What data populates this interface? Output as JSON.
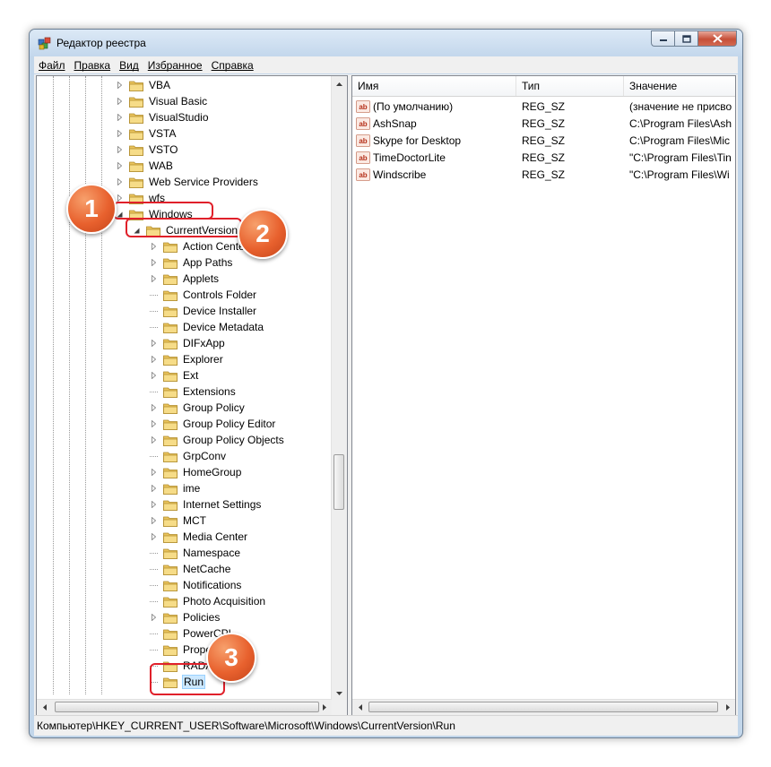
{
  "window": {
    "title": "Редактор реестра"
  },
  "menu": [
    "Файл",
    "Правка",
    "Вид",
    "Избранное",
    "Справка"
  ],
  "tree": [
    {
      "label": "VBA",
      "expander": "collapsed",
      "level": 0
    },
    {
      "label": "Visual Basic",
      "expander": "collapsed",
      "level": 0
    },
    {
      "label": "VisualStudio",
      "expander": "collapsed",
      "level": 0
    },
    {
      "label": "VSTA",
      "expander": "collapsed",
      "level": 0
    },
    {
      "label": "VSTO",
      "expander": "collapsed",
      "level": 0
    },
    {
      "label": "WAB",
      "expander": "collapsed",
      "level": 0
    },
    {
      "label": "Web Service Providers",
      "expander": "collapsed",
      "level": 0
    },
    {
      "label": "wfs",
      "expander": "collapsed",
      "level": 0
    },
    {
      "label": "Windows",
      "expander": "expanded",
      "level": 0
    },
    {
      "label": "CurrentVersion",
      "expander": "expanded",
      "level": 1
    },
    {
      "label": "Action Center",
      "expander": "collapsed",
      "level": 2
    },
    {
      "label": "App Paths",
      "expander": "collapsed",
      "level": 2
    },
    {
      "label": "Applets",
      "expander": "collapsed",
      "level": 2
    },
    {
      "label": "Controls Folder",
      "expander": "none",
      "level": 2
    },
    {
      "label": "Device Installer",
      "expander": "none",
      "level": 2
    },
    {
      "label": "Device Metadata",
      "expander": "none",
      "level": 2
    },
    {
      "label": "DIFxApp",
      "expander": "collapsed",
      "level": 2
    },
    {
      "label": "Explorer",
      "expander": "collapsed",
      "level": 2
    },
    {
      "label": "Ext",
      "expander": "collapsed",
      "level": 2
    },
    {
      "label": "Extensions",
      "expander": "none",
      "level": 2
    },
    {
      "label": "Group Policy",
      "expander": "collapsed",
      "level": 2
    },
    {
      "label": "Group Policy Editor",
      "expander": "collapsed",
      "level": 2
    },
    {
      "label": "Group Policy Objects",
      "expander": "collapsed",
      "level": 2
    },
    {
      "label": "GrpConv",
      "expander": "none",
      "level": 2
    },
    {
      "label": "HomeGroup",
      "expander": "collapsed",
      "level": 2
    },
    {
      "label": "ime",
      "expander": "collapsed",
      "level": 2
    },
    {
      "label": "Internet Settings",
      "expander": "collapsed",
      "level": 2
    },
    {
      "label": "MCT",
      "expander": "collapsed",
      "level": 2
    },
    {
      "label": "Media Center",
      "expander": "collapsed",
      "level": 2
    },
    {
      "label": "Namespace",
      "expander": "none",
      "level": 2
    },
    {
      "label": "NetCache",
      "expander": "none",
      "level": 2
    },
    {
      "label": "Notifications",
      "expander": "none",
      "level": 2
    },
    {
      "label": "Photo Acquisition",
      "expander": "none",
      "level": 2
    },
    {
      "label": "Policies",
      "expander": "collapsed",
      "level": 2
    },
    {
      "label": "PowerCPL",
      "expander": "none",
      "level": 2
    },
    {
      "label": "Prope",
      "expander": "none",
      "level": 2
    },
    {
      "label": "RADAR",
      "expander": "none",
      "level": 2
    },
    {
      "label": "Run",
      "expander": "none",
      "level": 2,
      "selected": true
    }
  ],
  "list": {
    "columns": [
      "Имя",
      "Тип",
      "Значение"
    ],
    "rows": [
      {
        "name": "(По умолчанию)",
        "type": "REG_SZ",
        "value": "(значение не присво"
      },
      {
        "name": "AshSnap",
        "type": "REG_SZ",
        "value": "C:\\Program Files\\Ash"
      },
      {
        "name": "Skype for Desktop",
        "type": "REG_SZ",
        "value": "C:\\Program Files\\Mic"
      },
      {
        "name": "TimeDoctorLite",
        "type": "REG_SZ",
        "value": "\"C:\\Program Files\\Tin"
      },
      {
        "name": "Windscribe",
        "type": "REG_SZ",
        "value": "\"C:\\Program Files\\Wi"
      }
    ]
  },
  "status": "Компьютер\\HKEY_CURRENT_USER\\Software\\Microsoft\\Windows\\CurrentVersion\\Run",
  "callouts": [
    {
      "label": "1",
      "target": "Windows"
    },
    {
      "label": "2",
      "target": "CurrentVersion"
    },
    {
      "label": "3",
      "target": "Run"
    }
  ]
}
